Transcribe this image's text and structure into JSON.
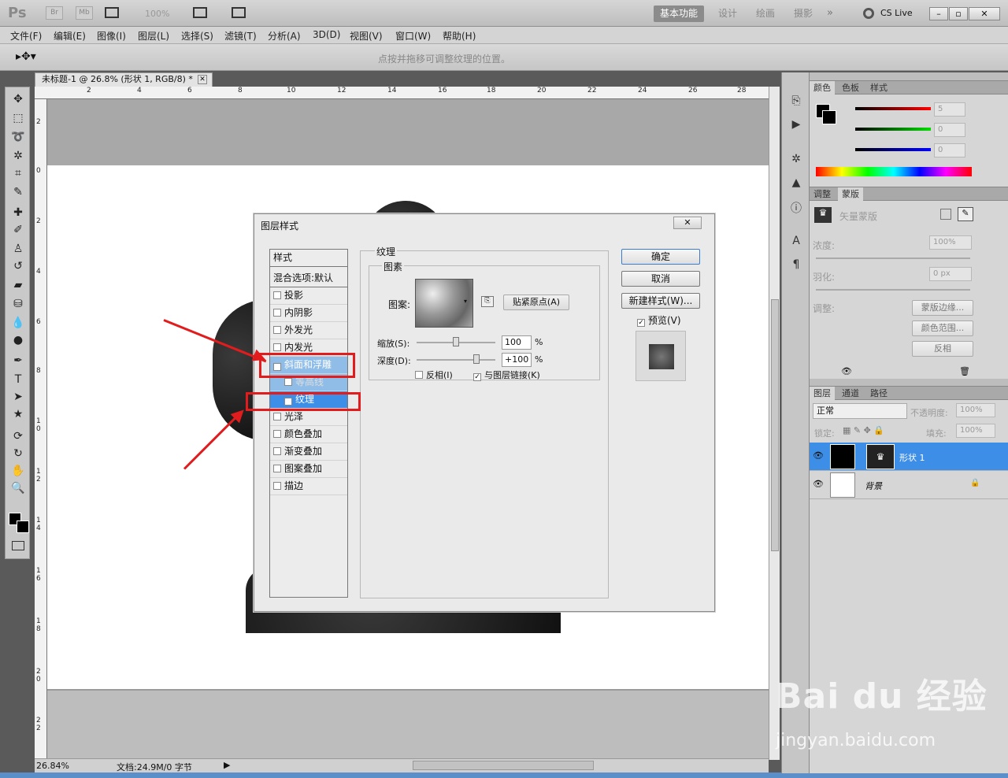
{
  "app": {
    "logo": "Ps",
    "zoom": "100%",
    "workspaces": [
      "基本功能",
      "设计",
      "绘画",
      "摄影"
    ],
    "cslive": "CS Live"
  },
  "menu": [
    "文件(F)",
    "编辑(E)",
    "图像(I)",
    "图层(L)",
    "选择(S)",
    "滤镜(T)",
    "分析(A)",
    "3D(D)",
    "视图(V)",
    "窗口(W)",
    "帮助(H)"
  ],
  "options_hint": "点按并拖移可调整纹理的位置。",
  "document": {
    "tab": "未标题-1 @ 26.8% (形状 1, RGB/8) *",
    "ruler_h": [
      "2",
      "4",
      "6",
      "8",
      "10",
      "12",
      "14",
      "16",
      "18",
      "20",
      "22",
      "24",
      "26",
      "28"
    ],
    "ruler_v": [
      "2",
      "0",
      "2",
      "4",
      "6",
      "8",
      "1 0",
      "1 2",
      "1 4",
      "1 6",
      "1 8",
      "2 0",
      "2 2"
    ],
    "zoom": "26.84%",
    "docsize": "文档:24.9M/0 字节"
  },
  "color_panel": {
    "tabs": [
      "颜色",
      "色板",
      "样式"
    ],
    "r": "5",
    "g": "0",
    "b": "0"
  },
  "mask_panel": {
    "tabs": [
      "调整",
      "蒙版"
    ],
    "title": "矢量蒙版",
    "density_label": "浓度:",
    "density": "100%",
    "feather_label": "羽化:",
    "feather": "0 px",
    "adjust_label": "调整:",
    "btn_edge": "蒙版边缘...",
    "btn_range": "颜色范围...",
    "btn_invert": "反相"
  },
  "layers_panel": {
    "tabs": [
      "图层",
      "通道",
      "路径"
    ],
    "blend": "正常",
    "opacity_label": "不透明度:",
    "opacity": "100%",
    "lock_label": "锁定:",
    "fill_label": "填充:",
    "fill": "100%",
    "layers": [
      "形状 1",
      "背景"
    ]
  },
  "dialog": {
    "title": "图层样式",
    "styles_header": "样式",
    "blend_options": "混合选项:默认",
    "styles": [
      {
        "label": "投影",
        "checked": false
      },
      {
        "label": "内阴影",
        "checked": false
      },
      {
        "label": "外发光",
        "checked": false
      },
      {
        "label": "内发光",
        "checked": false
      },
      {
        "label": "斜面和浮雕",
        "checked": true
      },
      {
        "label": "等高线",
        "checked": false
      },
      {
        "label": "纹理",
        "checked": true
      },
      {
        "label": "光泽",
        "checked": false
      },
      {
        "label": "颜色叠加",
        "checked": false
      },
      {
        "label": "渐变叠加",
        "checked": false
      },
      {
        "label": "图案叠加",
        "checked": false
      },
      {
        "label": "描边",
        "checked": false
      }
    ],
    "section": "纹理",
    "group": "图素",
    "pattern_label": "图案:",
    "snap_btn": "贴紧原点(A)",
    "scale_label": "缩放(S):",
    "scale": "100",
    "scale_unit": "%",
    "depth_label": "深度(D):",
    "depth": "+100",
    "depth_unit": "%",
    "invert": "反相(I)",
    "link": "与图层链接(K)",
    "ok": "确定",
    "cancel": "取消",
    "new_style": "新建样式(W)...",
    "preview": "预览(V)"
  },
  "watermark": {
    "brand": "Bai du 经验",
    "url": "jingyan.baidu.com"
  },
  "colors": {
    "highlight": "#3d8ee6",
    "selected_layer": "#3d8ee6",
    "annotation_red": "#e21c1c"
  }
}
